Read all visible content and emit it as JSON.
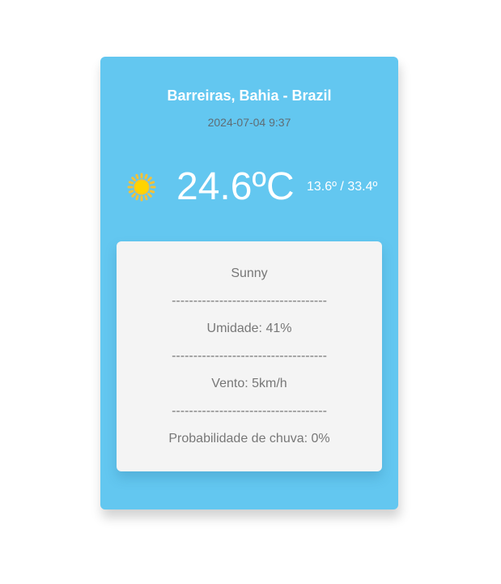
{
  "location": "Barreiras, Bahia - Brazil",
  "datetime": "2024-07-04 9:37",
  "weather": {
    "icon": "sun-icon",
    "temperature": "24.6ºC",
    "range": "13.6º / 33.4º"
  },
  "details": {
    "condition": "Sunny",
    "separator": "------------------------------------",
    "humidity": "Umidade: 41%",
    "wind": "Vento: 5km/h",
    "rain_probability": "Probabilidade de chuva: 0%"
  },
  "colors": {
    "card_background": "#63c7f0",
    "details_background": "#f4f4f4",
    "sun": "#ffd400",
    "sun_rays": "#f2c23a"
  }
}
